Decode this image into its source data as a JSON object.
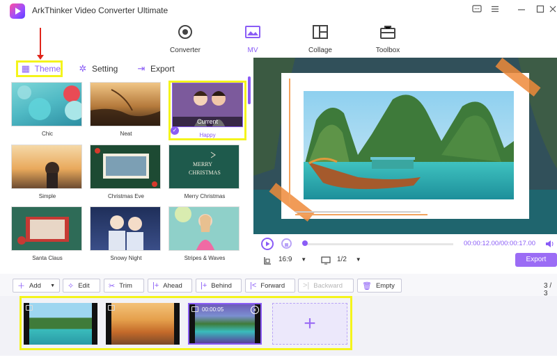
{
  "app": {
    "title": "ArkThinker Video Converter Ultimate"
  },
  "window_controls": [
    "feedback-icon",
    "menu-icon",
    "minimize-icon",
    "maximize-icon",
    "close-icon"
  ],
  "nav": {
    "items": [
      {
        "label": "Converter",
        "icon": "converter-icon"
      },
      {
        "label": "MV",
        "icon": "mv-icon",
        "active": true
      },
      {
        "label": "Collage",
        "icon": "collage-icon"
      },
      {
        "label": "Toolbox",
        "icon": "toolbox-icon"
      }
    ]
  },
  "subtabs": {
    "theme": "Theme",
    "setting": "Setting",
    "export": "Export"
  },
  "themes": [
    {
      "label": "Chic"
    },
    {
      "label": "Neat"
    },
    {
      "label": "Happy",
      "current_label": "Current",
      "selected": true
    },
    {
      "label": "Simple"
    },
    {
      "label": "Christmas Eve"
    },
    {
      "label": "Merry Christmas"
    },
    {
      "label": "Santa Claus"
    },
    {
      "label": "Snowy Night"
    },
    {
      "label": "Stripes & Waves"
    }
  ],
  "player": {
    "time_current": "00:00:12.00",
    "time_total": "00:00:17.00",
    "aspect": "16:9",
    "page": "1/2",
    "export_label": "Export",
    "progress": 0.0
  },
  "toolbar": {
    "add": "Add",
    "edit": "Edit",
    "trim": "Trim",
    "ahead": "Ahead",
    "behind": "Behind",
    "forward": "Forward",
    "backward": "Backward",
    "empty": "Empty",
    "count": "3 / 3"
  },
  "timeline": {
    "clip3_time": "00:00:05"
  },
  "colors": {
    "accent": "#8a5cf6",
    "highlight": "#f4f41c",
    "arrow": "#e0251b"
  }
}
